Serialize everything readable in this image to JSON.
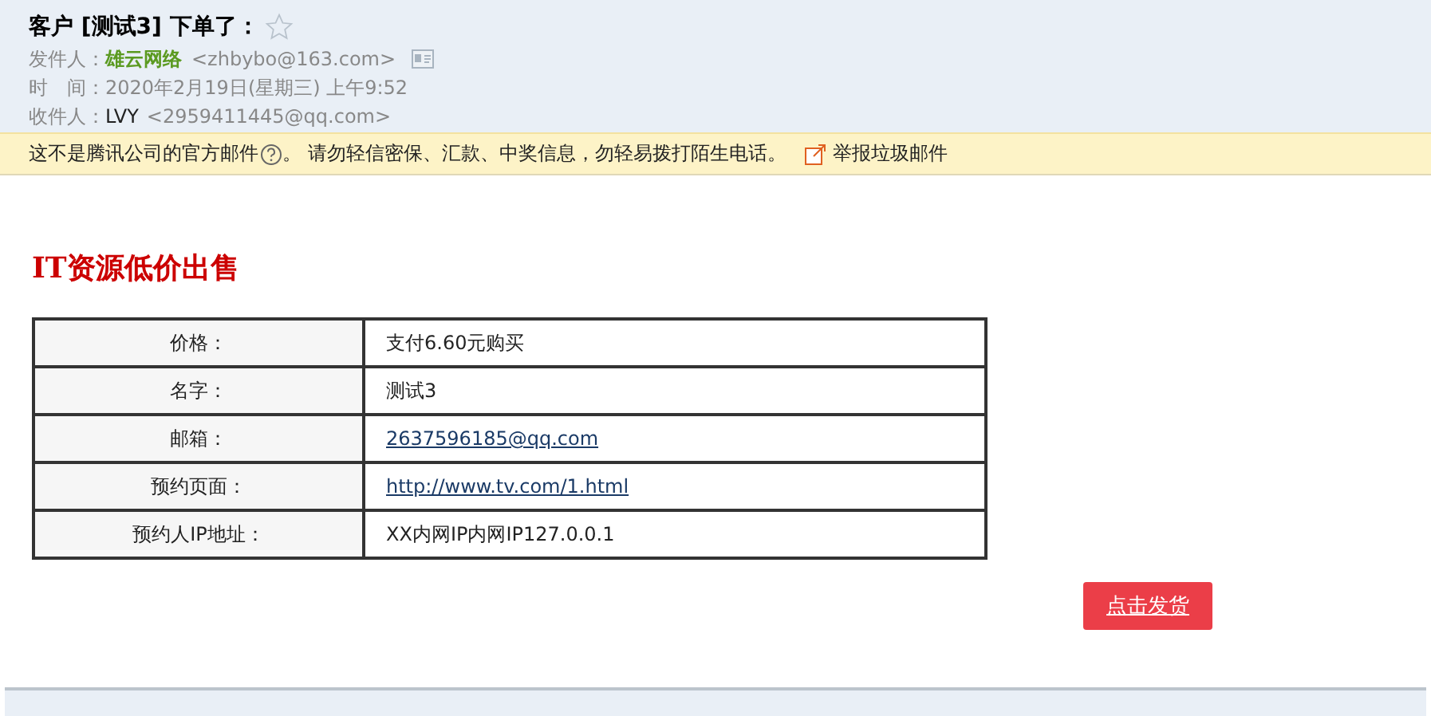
{
  "header": {
    "subject": "客户 [测试3] 下单了：",
    "starred": false,
    "fields": [
      {
        "label": "发件人：",
        "name": "雄云网络",
        "address": "<zhbybo@163.com>",
        "contact_card": true
      },
      {
        "label": "时　间：",
        "value": "2020年2月19日(星期三) 上午9:52"
      },
      {
        "label": "收件人：",
        "name": "LVY",
        "address": "<2959411445@qq.com>"
      }
    ]
  },
  "notice": {
    "text": "这不是腾讯公司的官方邮件",
    "after": "。 请勿轻信密保、汇款、中奖信息，勿轻易拨打陌生电话。",
    "report_link": "举报垃圾邮件"
  },
  "body": {
    "title": "IT资源低价出售",
    "rows": [
      {
        "label": "价格：",
        "value": "支付6.60元购买",
        "kind": "text"
      },
      {
        "label": "名字：",
        "value": "测试3",
        "kind": "text"
      },
      {
        "label": "邮箱：",
        "value": "2637596185@qq.com",
        "kind": "link"
      },
      {
        "label": "预约页面：",
        "value": "http://www.tv.com/1.html",
        "kind": "link"
      },
      {
        "label": "预约人IP地址：",
        "value": "XX内网IP内网IP127.0.0.1",
        "kind": "text"
      }
    ],
    "button": "点击发货"
  }
}
